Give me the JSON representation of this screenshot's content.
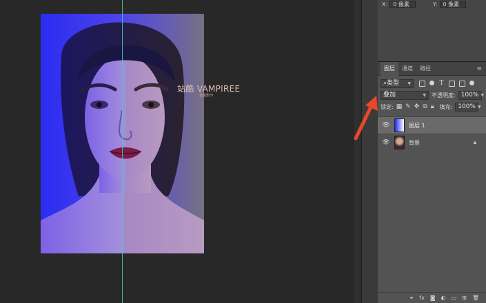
{
  "canvas": {
    "watermark_title": "站酷 VAMPIREE",
    "watermark_subtitle": "全能影Hi"
  },
  "properties": {
    "x_label": "X:",
    "x_value": "0 像素",
    "y_label": "Y:",
    "y_value": "0 像素"
  },
  "layers_panel": {
    "tabs": [
      {
        "label": "图层",
        "active": true
      },
      {
        "label": "通道",
        "active": false
      },
      {
        "label": "路径",
        "active": false
      }
    ],
    "filter_kind": "类型",
    "blend_mode": "叠加",
    "opacity_label": "不透明度:",
    "opacity_value": "100%",
    "lock_label": "锁定:",
    "fill_label": "填充:",
    "fill_value": "100%",
    "layers": [
      {
        "name": "图层 1",
        "selected": true,
        "thumbnail": "gradient-blue-white"
      },
      {
        "name": "背景",
        "selected": false,
        "thumbnail": "portrait",
        "locked": true
      }
    ],
    "bottom_icons": [
      "link-icon",
      "fx-icon",
      "mask-icon",
      "adjustment-icon",
      "folder-icon",
      "new-layer-icon",
      "trash-icon"
    ]
  },
  "colors": {
    "arrow": "#e8482c",
    "guide": "#3fd1b4",
    "overlay_blue": "#1d2bff"
  }
}
